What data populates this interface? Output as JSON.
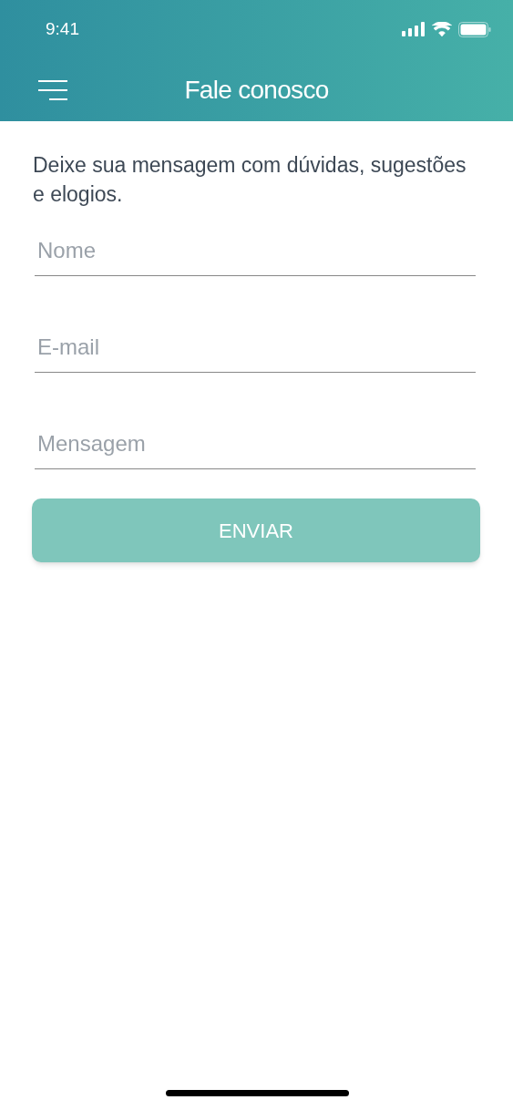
{
  "status_bar": {
    "time": "9:41"
  },
  "header": {
    "title": "Fale conosco"
  },
  "intro": "Deixe sua mensagem com dúvidas, sugestões e elogios.",
  "fields": [
    {
      "placeholder": "Nome"
    },
    {
      "placeholder": "E-mail"
    },
    {
      "placeholder": "Mensagem"
    }
  ],
  "submit_button": {
    "label": "ENVIAR"
  }
}
